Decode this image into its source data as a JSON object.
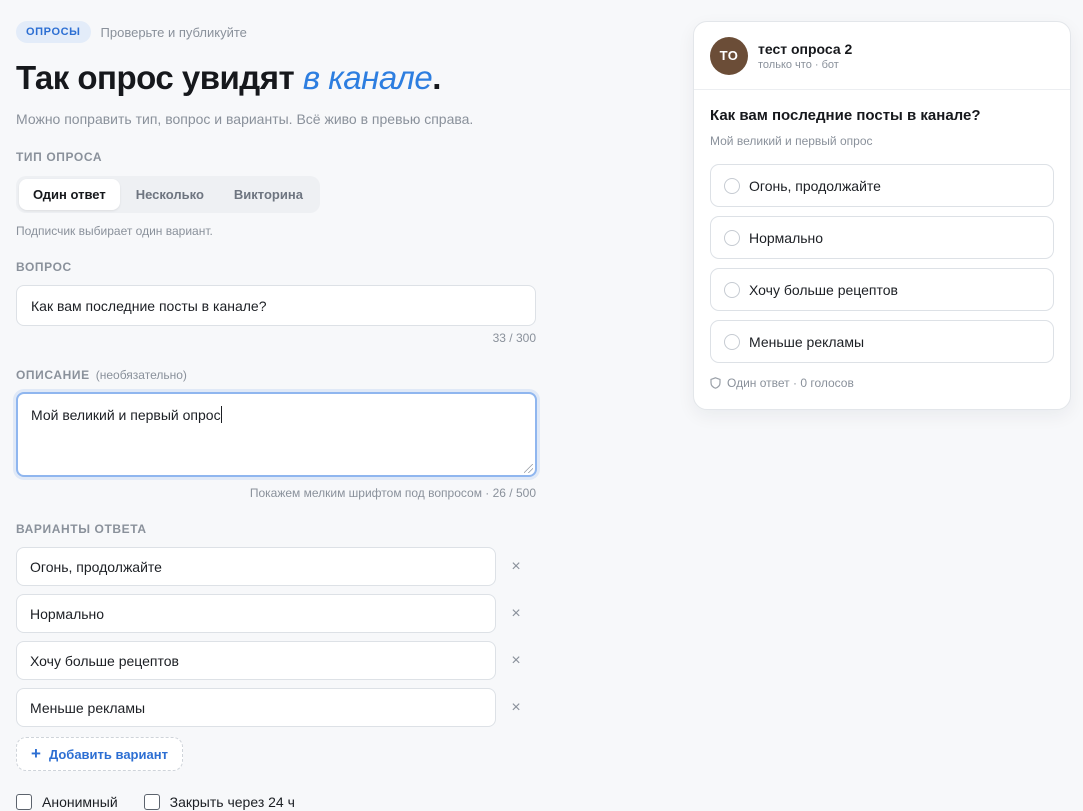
{
  "header": {
    "badge": "ОПРОСЫ",
    "hint": "Проверьте и публикуйте",
    "title_main": "Так опрос увидят ",
    "title_accent": "в канале",
    "title_end": ".",
    "subtitle": "Можно поправить тип, вопрос и варианты. Всё живо в превью справа."
  },
  "type": {
    "label": "ТИП ОПРОСА",
    "options": [
      "Один ответ",
      "Несколько",
      "Викторина"
    ],
    "selected": "Один ответ",
    "hint": "Подписчик выбирает один вариант."
  },
  "question": {
    "label": "ВОПРОС",
    "value": "Как вам последние посты в канале?",
    "counter": "33 / 300"
  },
  "description": {
    "label": "ОПИСАНИЕ",
    "optional": "(необязательно)",
    "value": "Мой великий и первый опрос",
    "counter": "Покажем мелким шрифтом под вопросом · 26 / 500"
  },
  "answers": {
    "label": "ВАРИАНТЫ ОТВЕТА",
    "items": [
      "Огонь, продолжайте",
      "Нормально",
      "Хочу больше рецептов",
      "Меньше рекламы"
    ],
    "remove_glyph": "×",
    "add_label": "Добавить вариант",
    "add_glyph": "+"
  },
  "settings": {
    "anonymous": "Анонимный",
    "close_24h": "Закрыть через 24 ч"
  },
  "preview": {
    "avatar": "ТО",
    "avatar_color": "#6b4d37",
    "name": "тест опроса 2",
    "meta": "только что · бот",
    "question": "Как вам последние посты в канале?",
    "description": "Мой великий и первый опрос",
    "options": [
      "Огонь, продолжайте",
      "Нормально",
      "Хочу больше рецептов",
      "Меньше рекламы"
    ],
    "footer": "Один ответ · 0 голосов"
  },
  "colors": {
    "accent": "#2d7ee0",
    "focus_border": "#8fb6ef"
  }
}
